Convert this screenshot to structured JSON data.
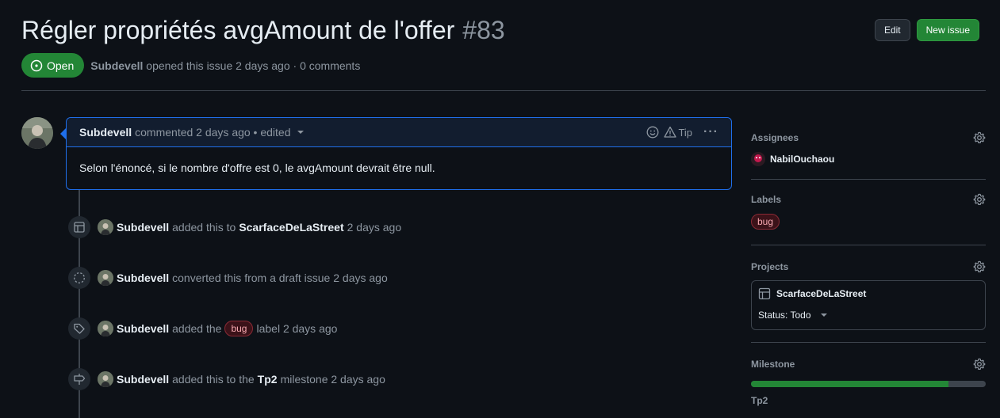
{
  "issue": {
    "title": "Régler propriétés avgAmount de l'offer",
    "number": "#83",
    "state": "Open",
    "author": "Subdevell",
    "opened_text": "opened this issue 2 days ago · 0 comments"
  },
  "header_buttons": {
    "edit": "Edit",
    "new_issue": "New issue"
  },
  "comment": {
    "author": "Subdevell",
    "meta": "commented 2 days ago • edited",
    "tip": "Tip",
    "body": "Selon l'énoncé, si le nombre d'offre est 0, le avgAmount devrait être null."
  },
  "timeline": [
    {
      "icon": "project-table-icon",
      "author": "Subdevell",
      "before": "added this to",
      "target": "ScarfaceDeLaStreet",
      "after": "2 days ago"
    },
    {
      "icon": "draft-issue-icon",
      "author": "Subdevell",
      "before": "converted this from a draft issue 2 days ago",
      "target": "",
      "after": ""
    },
    {
      "icon": "tag-icon",
      "author": "Subdevell",
      "before": "added the",
      "label": "bug",
      "after": "label 2 days ago"
    },
    {
      "icon": "milestone-icon",
      "author": "Subdevell",
      "before": "added this to the",
      "target": "Tp2",
      "after": "milestone 2 days ago"
    }
  ],
  "sidebar": {
    "assignees": {
      "heading": "Assignees",
      "user": "NabilOuchaou"
    },
    "labels": {
      "heading": "Labels",
      "items": [
        "bug"
      ]
    },
    "projects": {
      "heading": "Projects",
      "name": "ScarfaceDeLaStreet",
      "status": "Status: Todo"
    },
    "milestone": {
      "heading": "Milestone",
      "name": "Tp2",
      "progress": 0.84
    }
  },
  "colors": {
    "accent_green": "#238636",
    "comment_border": "#1f6feb",
    "label_bug": "#f7a8b0"
  }
}
